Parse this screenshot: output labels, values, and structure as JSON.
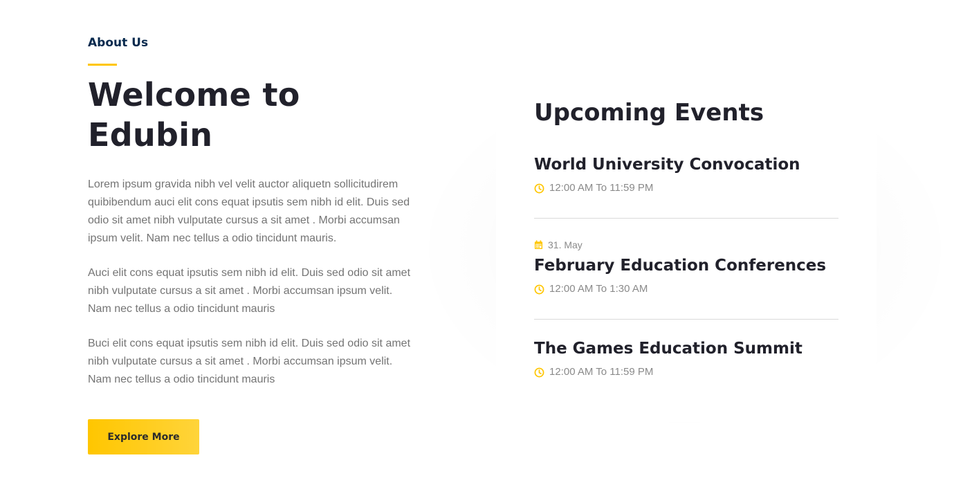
{
  "about": {
    "label": "About Us",
    "title": "Welcome to Edubin",
    "paragraphs": [
      "Lorem ipsum gravida nibh vel velit auctor aliquetn sollicitudirem quibibendum auci elit cons equat ipsutis sem nibh id elit. Duis sed odio sit amet nibh vulputate cursus a sit amet . Morbi accumsan ipsum velit. Nam nec tellus a odio tincidunt mauris.",
      "Auci elit cons equat ipsutis sem nibh id elit. Duis sed odio sit amet nibh vulputate cursus a sit amet . Morbi accumsan ipsum velit. Nam nec tellus a odio tincidunt mauris",
      "Buci elit cons equat ipsutis sem nibh id elit. Duis sed odio sit amet nibh vulputate cursus a sit amet . Morbi accumsan ipsum velit. Nam nec tellus a odio tincidunt mauris"
    ],
    "button_label": "Explore More"
  },
  "events": {
    "title": "Upcoming Events",
    "items": [
      {
        "name": "World University Convocation",
        "time": "12:00 AM To 11:59 PM"
      },
      {
        "date": "31. May",
        "name": "February Education Conferences",
        "time": "12:00 AM To 1:30 AM"
      },
      {
        "name": "The Games Education Summit",
        "time": "12:00 AM To 11:59 PM"
      }
    ]
  },
  "icons": {
    "time": "clock-icon",
    "date": "calendar-icon"
  },
  "colors": {
    "accent": "#ffc600",
    "heading": "#21212b",
    "label": "#07294d",
    "body_text": "#747474"
  }
}
